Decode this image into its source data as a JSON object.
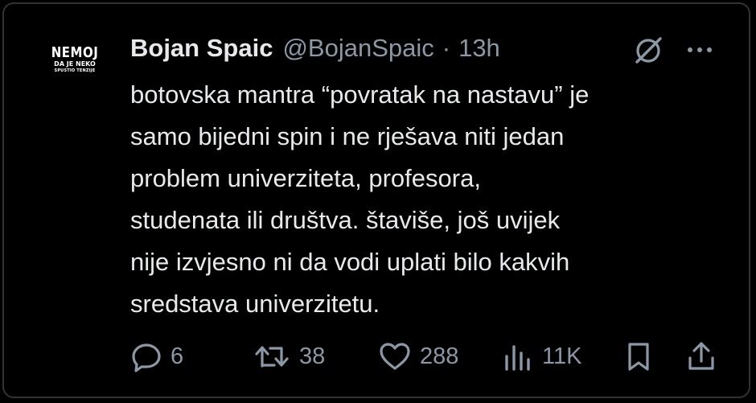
{
  "tweet": {
    "author_name": "Bojan Spaic",
    "author_handle": "@BojanSpaic",
    "separator": "·",
    "time": "13h",
    "avatar": {
      "line1": "NEMOJ",
      "line2": "DA JE NEKO",
      "line3": "SPUSTIO TENZIJE"
    },
    "text": "botovska mantra “povratak na nastavu” je\nsamo bijedni spin i ne rješava niti jedan\nproblem univerziteta, profesora,\nstudenata ili društva. štaviše, još uvijek\nnije izvjesno ni da vodi uplati bilo kakvih\nsredstava univerzitetu."
  },
  "actions": {
    "replies": "6",
    "reposts": "38",
    "likes": "288",
    "views": "11K"
  },
  "colors": {
    "background": "#000000",
    "text": "#e7e9ea",
    "muted": "#8b98a5",
    "border": "#2f3336"
  },
  "icons": {
    "grok": "grok-icon",
    "more": "more-icon",
    "reply": "reply-icon",
    "repost": "repost-icon",
    "like": "heart-icon",
    "views": "views-icon",
    "bookmark": "bookmark-icon",
    "share": "share-icon"
  }
}
